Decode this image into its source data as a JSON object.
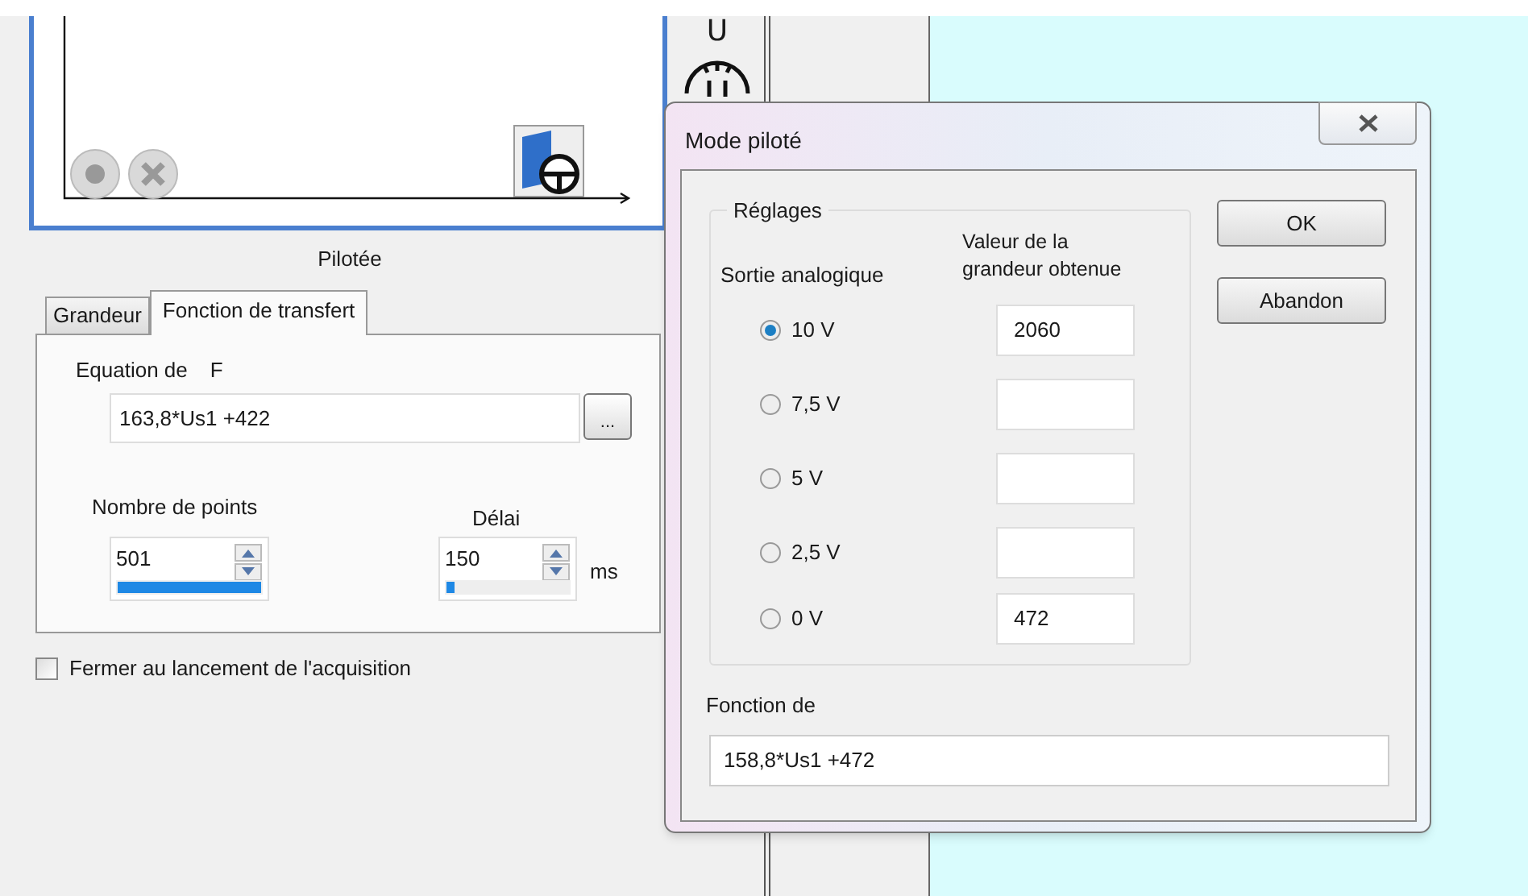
{
  "chart_panel": {
    "caption": "Pilotée"
  },
  "tabs": [
    {
      "label": "Grandeur",
      "selected": false
    },
    {
      "label": "Fonction de transfert",
      "selected": true
    }
  ],
  "transfer": {
    "equation_label": "Equation de",
    "variable": "F",
    "equation_value": "163,8*Us1 +422",
    "browse_button": "...",
    "points": {
      "label": "Nombre de points",
      "value": "501",
      "level": 1
    },
    "delay": {
      "label": "Délai",
      "value": "150",
      "unit": "ms",
      "level": 0.06
    }
  },
  "close_on_launch": {
    "label": "Fermer au lancement de l'acquisition",
    "checked": false
  },
  "toolbar_symbol": "U",
  "dialog": {
    "title": "Mode piloté",
    "group_title": "Réglages",
    "column_1": "Sortie analogique",
    "column_2": "Valeur de la grandeur obtenue",
    "rows": [
      {
        "label": "10 V",
        "selected": true,
        "value": "2060"
      },
      {
        "label": "7,5 V",
        "selected": false,
        "value": ""
      },
      {
        "label": "5 V",
        "selected": false,
        "value": ""
      },
      {
        "label": "2,5 V",
        "selected": false,
        "value": ""
      },
      {
        "label": "0 V",
        "selected": false,
        "value": "472"
      }
    ],
    "buttons": [
      "OK",
      "Abandon"
    ],
    "function_label": "Fonction de",
    "function_value": "158,8*Us1 +472"
  }
}
